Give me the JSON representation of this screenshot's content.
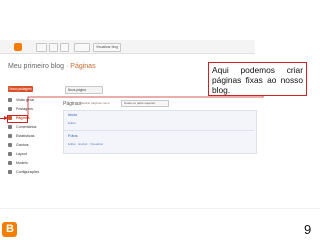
{
  "topbar": {
    "view_blog_label": "Visualizar blog"
  },
  "blog": {
    "name": "Meu primeiro blog",
    "separator": "·",
    "section": "Páginas"
  },
  "buttons": {
    "new_post": "Nova postagem",
    "new_page": "Nova página"
  },
  "sidebar": {
    "items": [
      {
        "label": "Visão geral",
        "icon": "overview-icon"
      },
      {
        "label": "Postagens",
        "icon": "posts-icon"
      },
      {
        "label": "Páginas",
        "icon": "pages-icon",
        "active": true
      },
      {
        "label": "Comentários",
        "icon": "comments-icon"
      },
      {
        "label": "Estatísticas",
        "icon": "stats-icon"
      },
      {
        "label": "Ganhos",
        "icon": "earnings-icon"
      },
      {
        "label": "Layout",
        "icon": "layout-icon"
      },
      {
        "label": "Modelo",
        "icon": "template-icon"
      },
      {
        "label": "Configurações",
        "icon": "settings-icon"
      }
    ]
  },
  "main": {
    "title": "Páginas",
    "hint": "Mostrar páginas como",
    "select_value": "Guias no parte superior",
    "pages": [
      {
        "title": "Início",
        "actions": "Editar"
      },
      {
        "title": "Fotos",
        "actions": "Editar · Excluir · Visualizar"
      }
    ]
  },
  "callout": {
    "text": "Aqui podemos criar páginas fixas ao nosso blog."
  },
  "footer": {
    "page_number": "9"
  },
  "colors": {
    "accent": "#d9502b",
    "annotation": "#cc2222",
    "brand": "#f57d00"
  }
}
